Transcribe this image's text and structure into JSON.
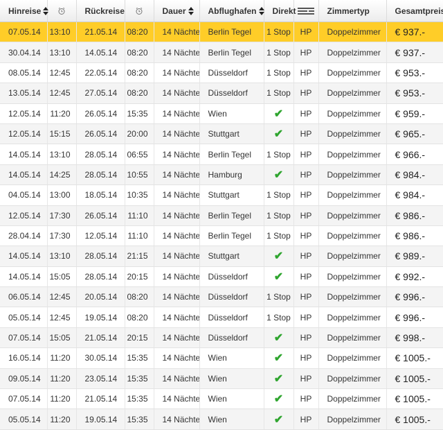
{
  "headers": {
    "departure": "Hinreise",
    "return": "Rückreise",
    "duration": "Dauer",
    "airport": "Abflughafen",
    "direct": "Direkt",
    "roomtype": "Zimmertyp",
    "total": "Gesamtpreis"
  },
  "rows": [
    {
      "dep": "07.05.14",
      "dep_time": "13:10",
      "ret": "21.05.14",
      "ret_time": "08:20",
      "duration": "14 Nächte",
      "airport": "Berlin Tegel",
      "direct": "1 Stop",
      "board": "HP",
      "room": "Doppelzimmer",
      "price": "€ 937.-",
      "highlight": true
    },
    {
      "dep": "30.04.14",
      "dep_time": "13:10",
      "ret": "14.05.14",
      "ret_time": "08:20",
      "duration": "14 Nächte",
      "airport": "Berlin Tegel",
      "direct": "1 Stop",
      "board": "HP",
      "room": "Doppelzimmer",
      "price": "€ 937.-"
    },
    {
      "dep": "08.05.14",
      "dep_time": "12:45",
      "ret": "22.05.14",
      "ret_time": "08:20",
      "duration": "14 Nächte",
      "airport": "Düsseldorf",
      "direct": "1 Stop",
      "board": "HP",
      "room": "Doppelzimmer",
      "price": "€ 953.-"
    },
    {
      "dep": "13.05.14",
      "dep_time": "12:45",
      "ret": "27.05.14",
      "ret_time": "08:20",
      "duration": "14 Nächte",
      "airport": "Düsseldorf",
      "direct": "1 Stop",
      "board": "HP",
      "room": "Doppelzimmer",
      "price": "€ 953.-"
    },
    {
      "dep": "12.05.14",
      "dep_time": "11:20",
      "ret": "26.05.14",
      "ret_time": "15:35",
      "duration": "14 Nächte",
      "airport": "Wien",
      "direct": "✔",
      "board": "HP",
      "room": "Doppelzimmer",
      "price": "€ 959.-"
    },
    {
      "dep": "12.05.14",
      "dep_time": "15:15",
      "ret": "26.05.14",
      "ret_time": "20:00",
      "duration": "14 Nächte",
      "airport": "Stuttgart",
      "direct": "✔",
      "board": "HP",
      "room": "Doppelzimmer",
      "price": "€ 965.-"
    },
    {
      "dep": "14.05.14",
      "dep_time": "13:10",
      "ret": "28.05.14",
      "ret_time": "06:55",
      "duration": "14 Nächte",
      "airport": "Berlin Tegel",
      "direct": "1 Stop",
      "board": "HP",
      "room": "Doppelzimmer",
      "price": "€ 966.-"
    },
    {
      "dep": "14.05.14",
      "dep_time": "14:25",
      "ret": "28.05.14",
      "ret_time": "10:55",
      "duration": "14 Nächte",
      "airport": "Hamburg",
      "direct": "✔",
      "board": "HP",
      "room": "Doppelzimmer",
      "price": "€ 984.-"
    },
    {
      "dep": "04.05.14",
      "dep_time": "13:00",
      "ret": "18.05.14",
      "ret_time": "10:35",
      "duration": "14 Nächte",
      "airport": "Stuttgart",
      "direct": "1 Stop",
      "board": "HP",
      "room": "Doppelzimmer",
      "price": "€ 984.-"
    },
    {
      "dep": "12.05.14",
      "dep_time": "17:30",
      "ret": "26.05.14",
      "ret_time": "11:10",
      "duration": "14 Nächte",
      "airport": "Berlin Tegel",
      "direct": "1 Stop",
      "board": "HP",
      "room": "Doppelzimmer",
      "price": "€ 986.-"
    },
    {
      "dep": "28.04.14",
      "dep_time": "17:30",
      "ret": "12.05.14",
      "ret_time": "11:10",
      "duration": "14 Nächte",
      "airport": "Berlin Tegel",
      "direct": "1 Stop",
      "board": "HP",
      "room": "Doppelzimmer",
      "price": "€ 986.-"
    },
    {
      "dep": "14.05.14",
      "dep_time": "13:10",
      "ret": "28.05.14",
      "ret_time": "21:15",
      "duration": "14 Nächte",
      "airport": "Stuttgart",
      "direct": "✔",
      "board": "HP",
      "room": "Doppelzimmer",
      "price": "€ 989.-"
    },
    {
      "dep": "14.05.14",
      "dep_time": "15:05",
      "ret": "28.05.14",
      "ret_time": "20:15",
      "duration": "14 Nächte",
      "airport": "Düsseldorf",
      "direct": "✔",
      "board": "HP",
      "room": "Doppelzimmer",
      "price": "€ 992.-"
    },
    {
      "dep": "06.05.14",
      "dep_time": "12:45",
      "ret": "20.05.14",
      "ret_time": "08:20",
      "duration": "14 Nächte",
      "airport": "Düsseldorf",
      "direct": "1 Stop",
      "board": "HP",
      "room": "Doppelzimmer",
      "price": "€ 996.-"
    },
    {
      "dep": "05.05.14",
      "dep_time": "12:45",
      "ret": "19.05.14",
      "ret_time": "08:20",
      "duration": "14 Nächte",
      "airport": "Düsseldorf",
      "direct": "1 Stop",
      "board": "HP",
      "room": "Doppelzimmer",
      "price": "€ 996.-"
    },
    {
      "dep": "07.05.14",
      "dep_time": "15:05",
      "ret": "21.05.14",
      "ret_time": "20:15",
      "duration": "14 Nächte",
      "airport": "Düsseldorf",
      "direct": "✔",
      "board": "HP",
      "room": "Doppelzimmer",
      "price": "€ 998.-"
    },
    {
      "dep": "16.05.14",
      "dep_time": "11:20",
      "ret": "30.05.14",
      "ret_time": "15:35",
      "duration": "14 Nächte",
      "airport": "Wien",
      "direct": "✔",
      "board": "HP",
      "room": "Doppelzimmer",
      "price": "€ 1005.-"
    },
    {
      "dep": "09.05.14",
      "dep_time": "11:20",
      "ret": "23.05.14",
      "ret_time": "15:35",
      "duration": "14 Nächte",
      "airport": "Wien",
      "direct": "✔",
      "board": "HP",
      "room": "Doppelzimmer",
      "price": "€ 1005.-"
    },
    {
      "dep": "07.05.14",
      "dep_time": "11:20",
      "ret": "21.05.14",
      "ret_time": "15:35",
      "duration": "14 Nächte",
      "airport": "Wien",
      "direct": "✔",
      "board": "HP",
      "room": "Doppelzimmer",
      "price": "€ 1005.-"
    },
    {
      "dep": "05.05.14",
      "dep_time": "11:20",
      "ret": "19.05.14",
      "ret_time": "15:35",
      "duration": "14 Nächte",
      "airport": "Wien",
      "direct": "✔",
      "board": "HP",
      "room": "Doppelzimmer",
      "price": "€ 1005.-"
    }
  ],
  "colors": {
    "highlight": "#ffcd28",
    "check": "#2fa52f"
  },
  "icons": {
    "time": "alarm-clock-icon",
    "board": "cutlery-icon",
    "sort": "sort-arrows-icon"
  }
}
